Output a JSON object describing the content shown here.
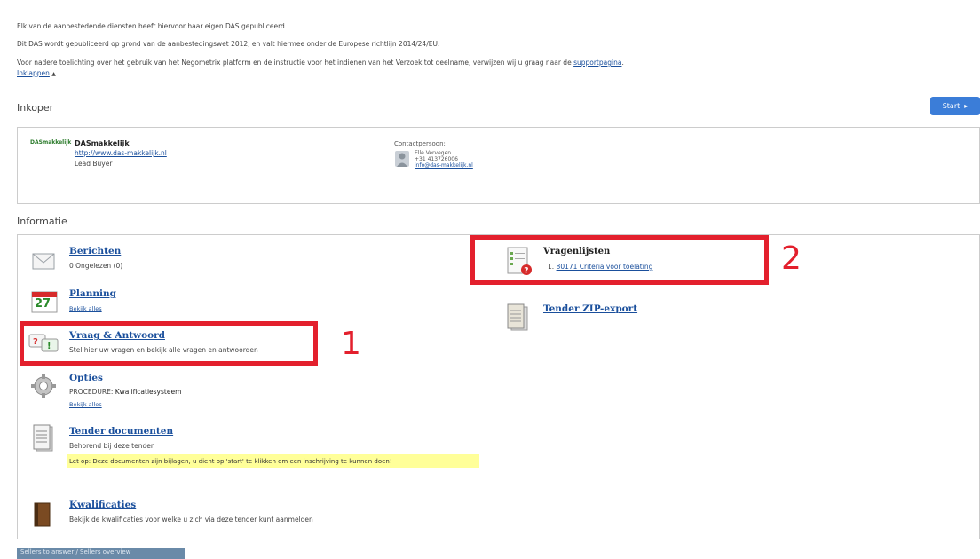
{
  "intro": {
    "line1": "Elk van de aanbestedende diensten heeft hiervoor haar eigen DAS gepubliceerd.",
    "line2": "Dit DAS wordt gepubliceerd op grond van de aanbestedingswet 2012, en valt hiermee onder de Europese richtlijn 2014/24/EU.",
    "line3_prefix": "Voor nadere toelichting over het gebruik van het Negometrix platform en de instructie voor het indienen van het Verzoek tot deelname, verwijzen wij u graag naar de ",
    "line3_link": "supportpagina",
    "line3_suffix": ".",
    "collapse": "Inklappen",
    "collapse_arrow": "▲"
  },
  "inkoper": {
    "title": "Inkoper",
    "start_label": "Start",
    "logo_text": "DASmakkelijk",
    "org_name": "DASmakkelijk",
    "org_url": "http://www.das-makkelijk.nl",
    "role": "Lead Buyer",
    "contact_label": "Contactpersoon:",
    "contact_name": "Elle Vervegen",
    "contact_phone": "+31 413726006",
    "contact_email": "info@das-makkelijk.nl"
  },
  "informatie": {
    "title": "Informatie",
    "berichten": {
      "title": "Berichten",
      "sub": "0 Ongelezen (0)"
    },
    "planning": {
      "title": "Planning",
      "link": "Bekijk alles",
      "day": "27"
    },
    "vraag": {
      "title": "Vraag & Antwoord",
      "sub": "Stel hier uw vragen en bekijk alle vragen en antwoorden"
    },
    "opties": {
      "title": "Opties",
      "label": "PROCEDURE:",
      "value": "Kwalificatiesysteem",
      "link": "Bekijk alles"
    },
    "tender_docs": {
      "title": "Tender documenten",
      "sub": "Behorend bij deze tender",
      "notice": "Let op: Deze documenten zijn bijlagen, u dient op 'start' te klikken om een inschrijving te kunnen doen!"
    },
    "kwalificaties": {
      "title": "Kwalificaties",
      "sub": "Bekijk de kwalificaties voor welke u zich via deze tender kunt aanmelden"
    },
    "vragenlijsten": {
      "title": "Vragenlijsten",
      "item_num": "1.",
      "item_link": "80171 Criteria voor toelating"
    },
    "zip_export": {
      "title": "Tender ZIP-export"
    }
  },
  "annotations": {
    "one": "1",
    "two": "2"
  },
  "bottom_button": "Sellers to answer / Sellers overview",
  "colors": {
    "accent": "#3b7dd8",
    "annotation_red": "#e3202d",
    "link": "#1a4f9c",
    "notice_yellow": "#ffff99"
  }
}
